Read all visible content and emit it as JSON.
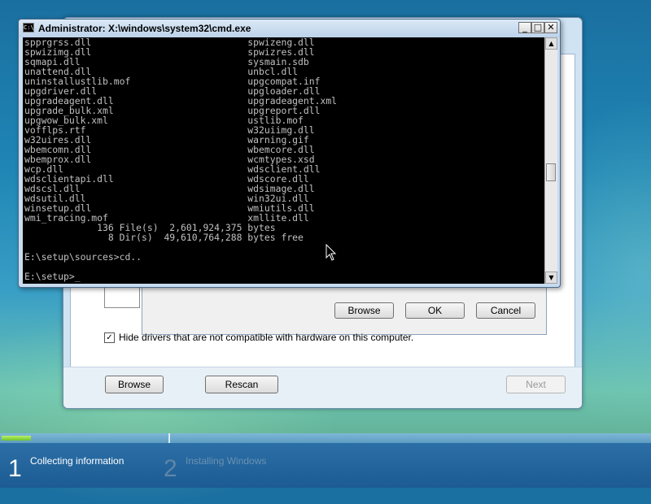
{
  "cmd_window": {
    "title": "Administrator: X:\\windows\\system32\\cmd.exe",
    "console_lines": [
      "spprgrss.dll                            spwizeng.dll",
      "spwizimg.dll                            spwizres.dll",
      "sqmapi.dll                              sysmain.sdb",
      "unattend.dll                            unbcl.dll",
      "uninstallustlib.mof                     upgcompat.inf",
      "upgdriver.dll                           upgloader.dll",
      "upgradeagent.dll                        upgradeagent.xml",
      "upgrade_bulk.xml                        upgreport.dll",
      "upgwow_bulk.xml                         ustlib.mof",
      "vofflps.rtf                             w32uiimg.dll",
      "w32uires.dll                            warning.gif",
      "wbemcomn.dll                            wbemcore.dll",
      "wbemprox.dll                            wcmtypes.xsd",
      "wcp.dll                                 wdsclient.dll",
      "wdsclientapi.dll                        wdscore.dll",
      "wdscsl.dll                              wdsimage.dll",
      "wdsutil.dll                             win32ui.dll",
      "winsetup.dll                            wmiutils.dll",
      "wmi_tracing.mof                         xmllite.dll",
      "             136 File(s)  2,601,924,375 bytes",
      "               8 Dir(s)  49,610,764,288 bytes free",
      "",
      "E:\\setup\\sources>cd..",
      "",
      "E:\\setup>_"
    ]
  },
  "dialog_buttons": {
    "browse": "Browse",
    "ok": "OK",
    "cancel": "Cancel"
  },
  "wizard": {
    "hide_drivers_label": "Hide drivers that are not compatible with hardware on this computer.",
    "hide_drivers_checked": true,
    "browse": "Browse",
    "rescan": "Rescan",
    "next": "Next"
  },
  "progress": {
    "fraction": 0.045
  },
  "steps": [
    {
      "number": "1",
      "label": "Collecting information",
      "active": true
    },
    {
      "number": "2",
      "label": "Installing Windows",
      "active": false
    }
  ],
  "colors": {
    "accent": "#1c5b93",
    "progress": "#6fc32e",
    "console_bg": "#000000",
    "console_text": "#c0c0c0"
  }
}
